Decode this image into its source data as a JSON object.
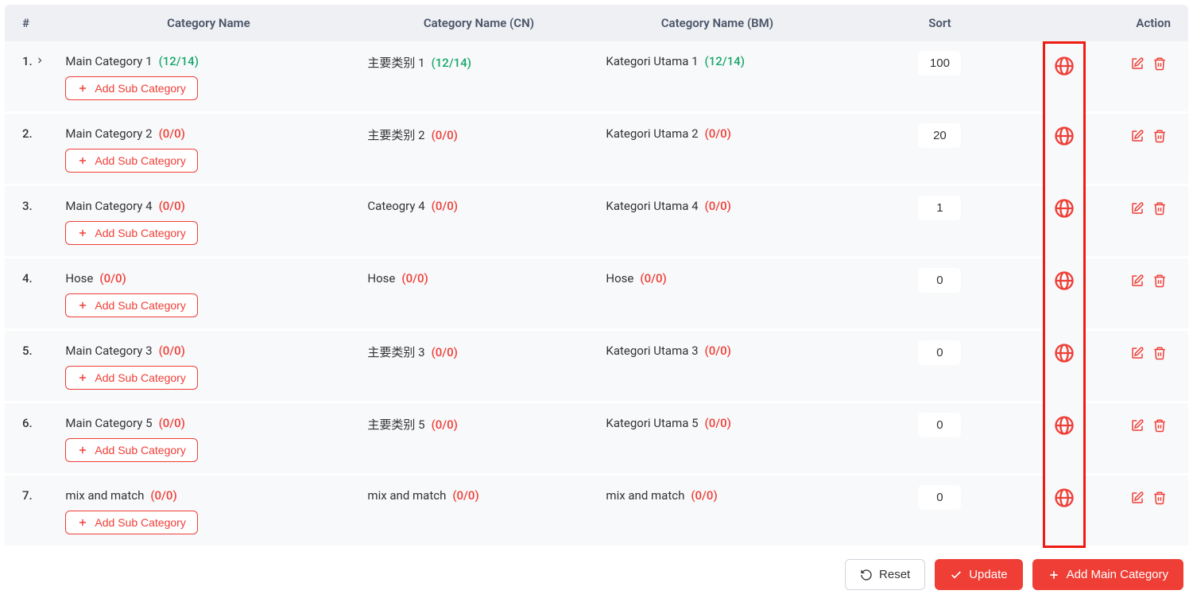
{
  "headers": {
    "idx": "#",
    "name": "Category Name",
    "cn": "Category Name (CN)",
    "bm": "Category Name (BM)",
    "sort": "Sort",
    "action": "Action"
  },
  "rows": [
    {
      "n": "1.",
      "expand": true,
      "name": "Main Category 1",
      "cn": "主要类别 1",
      "bm": "Kategori Utama 1",
      "ratio": "(12/14)",
      "rc": "green",
      "sort": "100"
    },
    {
      "n": "2.",
      "expand": false,
      "name": "Main Category 2",
      "cn": "主要类别 2",
      "bm": "Kategori Utama 2",
      "ratio": "(0/0)",
      "rc": "red",
      "sort": "20"
    },
    {
      "n": "3.",
      "expand": false,
      "name": "Main Category 4",
      "cn": "Cateogry 4",
      "bm": "Kategori Utama 4",
      "ratio": "(0/0)",
      "rc": "red",
      "sort": "1"
    },
    {
      "n": "4.",
      "expand": false,
      "name": "Hose",
      "cn": "Hose",
      "bm": "Hose",
      "ratio": "(0/0)",
      "rc": "red",
      "sort": "0"
    },
    {
      "n": "5.",
      "expand": false,
      "name": "Main Category 3",
      "cn": "主要类别 3",
      "bm": "Kategori Utama 3",
      "ratio": "(0/0)",
      "rc": "red",
      "sort": "0"
    },
    {
      "n": "6.",
      "expand": false,
      "name": "Main Category 5",
      "cn": "主要类别 5",
      "bm": "Kategori Utama 5",
      "ratio": "(0/0)",
      "rc": "red",
      "sort": "0"
    },
    {
      "n": "7.",
      "expand": false,
      "name": "mix and match",
      "cn": "mix and match",
      "bm": "mix and match",
      "ratio": "(0/0)",
      "rc": "red",
      "sort": "0"
    }
  ],
  "buttons": {
    "addsub": "Add Sub Category",
    "reset": "Reset",
    "update": "Update",
    "addmain": "Add Main Category"
  }
}
